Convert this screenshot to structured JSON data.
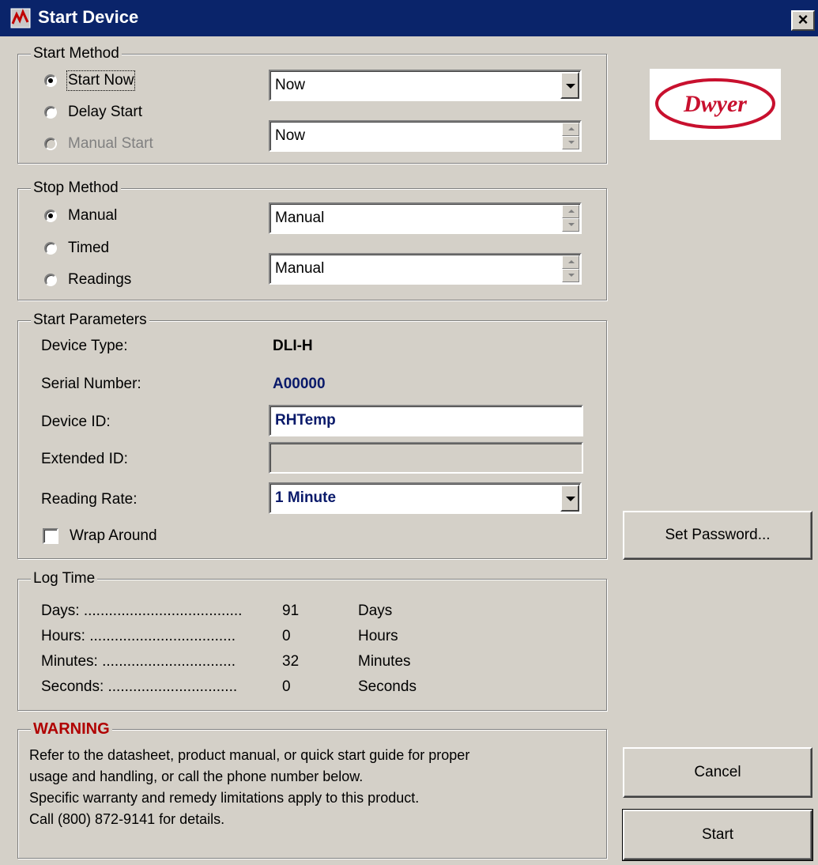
{
  "window": {
    "title": "Start Device",
    "close_label": "✕"
  },
  "start_method": {
    "legend": "Start Method",
    "options": [
      {
        "label": "Start Now",
        "selected": true,
        "enabled": true
      },
      {
        "label": "Delay Start",
        "selected": false,
        "enabled": true
      },
      {
        "label": "Manual Start",
        "selected": false,
        "enabled": false
      }
    ],
    "start_dropdown_value": "Now",
    "start_spinner_value": "Now"
  },
  "stop_method": {
    "legend": "Stop Method",
    "options": [
      {
        "label": "Manual",
        "selected": true
      },
      {
        "label": "Timed",
        "selected": false
      },
      {
        "label": "Readings",
        "selected": false
      }
    ],
    "spinner1_value": "Manual",
    "spinner2_value": "Manual"
  },
  "start_parameters": {
    "legend": "Start Parameters",
    "device_type_label": "Device Type:",
    "device_type_value": "DLI-H",
    "serial_label": "Serial Number:",
    "serial_value": "A00000",
    "device_id_label": "Device ID:",
    "device_id_value": "RHTemp",
    "extended_id_label": "Extended ID:",
    "extended_id_value": "",
    "reading_rate_label": "Reading Rate:",
    "reading_rate_value": "1 Minute",
    "wrap_around_label": "Wrap Around",
    "wrap_around_checked": false
  },
  "log_time": {
    "legend": "Log Time",
    "rows": [
      {
        "label": "Days: ......................................",
        "value": "91",
        "unit": "Days"
      },
      {
        "label": "Hours: ...................................",
        "value": "0",
        "unit": "Hours"
      },
      {
        "label": "Minutes: ................................",
        "value": "32",
        "unit": "Minutes"
      },
      {
        "label": "Seconds: ...............................",
        "value": "0",
        "unit": "Seconds"
      }
    ]
  },
  "warning": {
    "legend": "WARNING",
    "lines": [
      "Refer to the datasheet, product manual, or quick start guide for proper",
      "usage and handling, or call the phone number below.",
      "Specific warranty and remedy limitations apply to this product.",
      "Call (800) 872-9141 for details."
    ]
  },
  "logo": {
    "text": "Dwyer",
    "color": "#c8102e"
  },
  "buttons": {
    "set_password": "Set Password...",
    "cancel": "Cancel",
    "start": "Start"
  },
  "colors": {
    "title_bar": "#0a246a",
    "dialog_bg": "#d4d0c8",
    "warning": "#b00000",
    "value_blue": "#0a1a6a"
  }
}
